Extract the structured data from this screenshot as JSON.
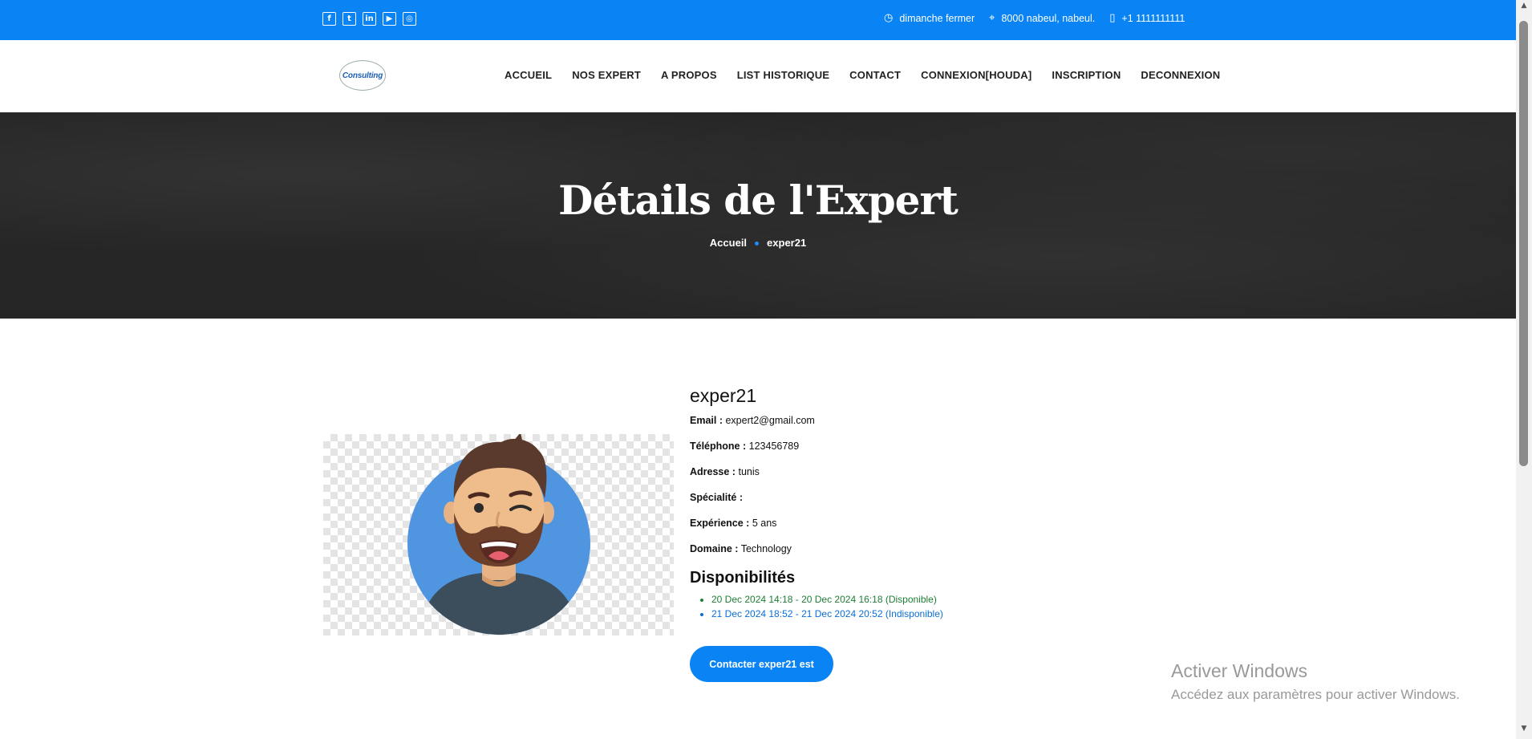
{
  "topbar": {
    "social_icons": [
      "facebook-icon",
      "twitter-icon",
      "linkedin-icon",
      "youtube-icon",
      "instagram-icon"
    ],
    "hours": "dimanche fermer",
    "address": "8000 nabeul, nabeul.",
    "phone": "+1 1111111111",
    "background": "#0a84f5"
  },
  "nav": {
    "logo_text": "Consulting",
    "items": [
      "ACCUEIL",
      "NOS EXPERT",
      "A PROPOS",
      "LIST HISTORIQUE",
      "CONTACT",
      "CONNEXION[HOUDA]",
      "INSCRIPTION",
      "DECONNEXION"
    ]
  },
  "hero": {
    "title": "Détails de l'Expert",
    "breadcrumb": [
      "Accueil",
      "exper21"
    ]
  },
  "expert": {
    "name": "exper21",
    "email_label": "Email :",
    "email": "expert2@gmail.com",
    "phone_label": "Téléphone :",
    "phone": "123456789",
    "address_label": "Adresse :",
    "address": "tunis",
    "specialty_label": "Spécialité :",
    "specialty": "",
    "experience_label": "Expérience :",
    "experience": "5 ans",
    "domain_label": "Domaine :",
    "domain": "Technology"
  },
  "availability": {
    "title": "Disponibilités",
    "slots": [
      {
        "text": "20 Dec 2024 14:18 - 20 Dec 2024 16:18 (Disponible)",
        "color": "#1e7e34"
      },
      {
        "text": "21 Dec 2024 18:52 - 21 Dec 2024 20:52 (Indisponible)",
        "color": "#0a6fd6"
      }
    ]
  },
  "contact_button": "Contacter exper21 est",
  "watermark": {
    "line1": "Activer Windows",
    "line2": "Accédez aux paramètres pour activer Windows."
  }
}
